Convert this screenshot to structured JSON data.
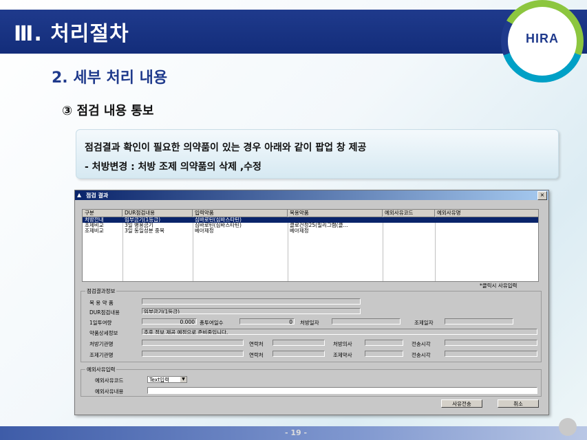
{
  "header": {
    "title": "Ⅲ. 처리절차"
  },
  "logo": {
    "text": "HIRA"
  },
  "section": {
    "subtitle": "2. 세부 처리 내용",
    "item": "③ 점검 내용 통보"
  },
  "note": {
    "line1": "점검결과 확인이 필요한 의약품이 있는 경우 아래와 같이 팝업 창 제공",
    "line2": "- 처방변경 : 처방 조제 의약품의 삭제 ,수정"
  },
  "window": {
    "title": "점검 결과",
    "close": "×",
    "grid": {
      "columns": [
        "구분",
        "DUR점검내용",
        "입력약품",
        "복용약품",
        "예외사유코드",
        "예외사유명"
      ],
      "rows": [
        [
          "처방전내",
          "임부금기(1등급)",
          "심바로틴(심바스타틴)",
          "",
          "",
          ""
        ],
        [
          "조제비교",
          "3일 병용금기",
          "심바로틴(심바스타틴)",
          "클로건정25(밀리그램(클...",
          "",
          ""
        ],
        [
          "조제비교",
          "3일 동일성분 중복",
          "베아제정",
          "베아제정",
          "",
          ""
        ]
      ]
    },
    "click_hint": "*클릭시 사유입력",
    "detail": {
      "legend": "점검결과정보",
      "drug_label": "복 용 약 품",
      "drug_value": "",
      "dur_label": "DUR점검내용",
      "dur_value": "임부금기(1등급)",
      "dose_label": "1일투여량",
      "dose_value": "0.000",
      "days_label": "총투여일수",
      "days_value": "0",
      "rx_date_label": "처방일자",
      "rx_date_value": "",
      "disp_date_label": "조제일자",
      "disp_date_value": "",
      "info_label": "약품상세정보",
      "info_value": "추후 정보 제공 예정으로 준비중입니다.",
      "rx_inst_label": "처방기관명",
      "contact1_label": "연락처",
      "doctor_label": "처방의사",
      "tx_time1_label": "전송시각",
      "disp_inst_label": "조제기관명",
      "contact2_label": "연락처",
      "pharmacist_label": "조제약사",
      "tx_time2_label": "전송시각"
    },
    "exception": {
      "legend": "예외사유입력",
      "code_label": "예외사유코드",
      "code_value": "Text입력",
      "content_label": "예외사유내용",
      "content_value": ""
    },
    "buttons": {
      "send": "사유전송",
      "cancel": "취소"
    }
  },
  "footer": {
    "page": "- 19 -"
  }
}
